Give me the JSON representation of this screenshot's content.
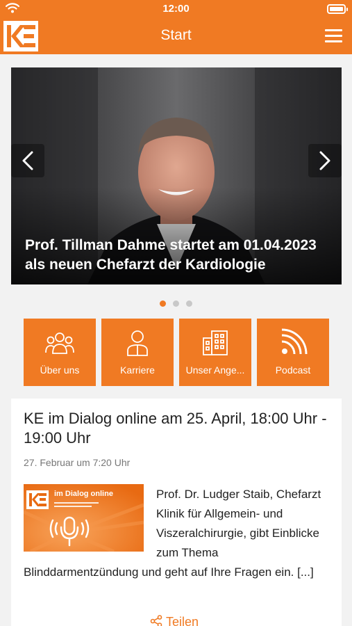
{
  "status_bar": {
    "time": "12:00"
  },
  "header": {
    "logo_text": "KE",
    "title": "Start"
  },
  "slider": {
    "caption": "Prof. Tillman Dahme startet am 01.04.2023 als neuen Chefarzt der Kardiologie",
    "slide_count": 3,
    "active_index": 0
  },
  "tiles": [
    {
      "label": "Über uns",
      "icon": "team-icon"
    },
    {
      "label": "Karriere",
      "icon": "person-icon"
    },
    {
      "label": "Unser Ange...",
      "icon": "building-icon"
    },
    {
      "label": "Podcast",
      "icon": "rss-icon"
    }
  ],
  "news": {
    "title": "KE im Dialog online am 25. April, 18:00 Uhr - 19:00 Uhr",
    "date": "27. Februar um 7:20 Uhr",
    "image_title": "im Dialog online",
    "text": "Prof. Dr. Ludger Staib, Chefarzt Klinik für Allgemein- und Viszeralchirurgie, gibt Einblicke zum Thema Blinddarmentzündung und geht auf Ihre Fragen ein. [...]",
    "share_label": "Teilen"
  },
  "colors": {
    "accent": "#f07a23",
    "background": "#f2f2f2"
  }
}
